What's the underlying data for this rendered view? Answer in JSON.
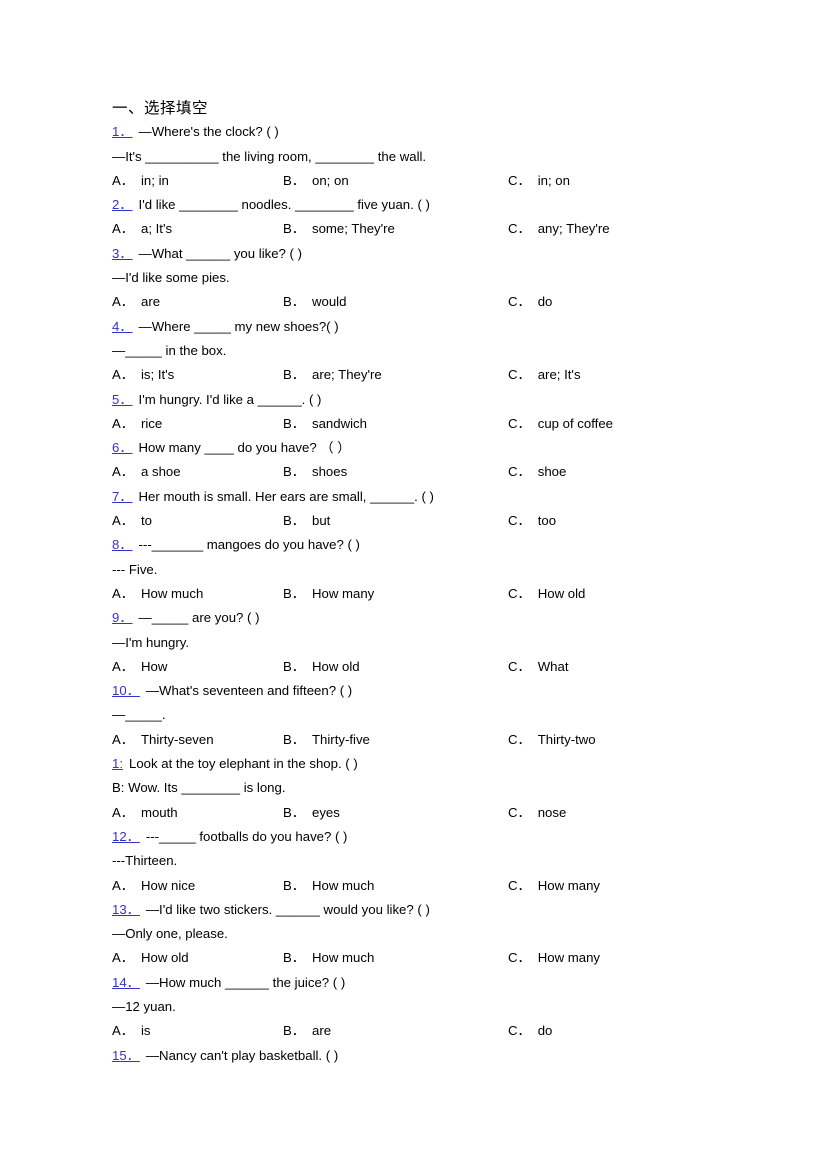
{
  "document": {
    "section_heading": "一、选择填空",
    "option_columns": [
      "A．",
      "B．",
      "C．"
    ],
    "questions": [
      {
        "number": "1．",
        "lines": [
          "—Where's the clock? ( )",
          "—It's __________ the living room, ________ the wall."
        ],
        "options": [
          "in; in",
          "on; on",
          "in; on"
        ]
      },
      {
        "number": "2．",
        "lines": [
          "I'd like ________ noodles. ________ five yuan. ( )"
        ],
        "options": [
          "a; It's",
          "some; They're",
          "any; They're"
        ]
      },
      {
        "number": "3．",
        "lines": [
          "—What ______ you like? ( )",
          "—I'd like some pies."
        ],
        "options": [
          "are",
          "would",
          "do"
        ]
      },
      {
        "number": "4．",
        "lines": [
          "—Where _____ my new shoes?( )",
          "—_____ in the box."
        ],
        "options": [
          "is; It's",
          "are; They're",
          "are; It's"
        ]
      },
      {
        "number": "5．",
        "lines": [
          "I'm hungry. I'd like a ______. ( )"
        ],
        "options": [
          "rice",
          "sandwich",
          "cup of coffee"
        ]
      },
      {
        "number": "6．",
        "lines": [
          "How many ____ do you have? （ ）"
        ],
        "options": [
          "a shoe",
          "shoes",
          "shoe"
        ]
      },
      {
        "number": "7．",
        "lines": [
          "Her mouth is small. Her ears are small, ______. ( )"
        ],
        "options": [
          "to",
          "but",
          "too"
        ]
      },
      {
        "number": "8．",
        "lines": [
          "---_______ mangoes do you have? ( )",
          "--- Five."
        ],
        "options": [
          "How much",
          "How many",
          "How old"
        ]
      },
      {
        "number": "9．",
        "lines": [
          "—_____ are you? ( )",
          "—I'm hungry."
        ],
        "options": [
          "How",
          "How old",
          "What"
        ]
      },
      {
        "number": "10．",
        "lines": [
          "—What's seventeen and fifteen? ( )",
          "—_____."
        ],
        "options": [
          "Thirty-seven",
          "Thirty-five",
          "Thirty-two"
        ]
      },
      {
        "number": "1:",
        "lines": [
          "Look at the toy elephant in the shop. ( )",
          "B: Wow. Its ________ is long."
        ],
        "options": [
          "mouth",
          "eyes",
          "nose"
        ]
      },
      {
        "number": "12．",
        "lines": [
          "---_____ footballs do you have? ( )",
          "---Thirteen."
        ],
        "options": [
          "How nice",
          "How much",
          "How many"
        ]
      },
      {
        "number": "13．",
        "lines": [
          "—I'd like two stickers. ______ would you like? ( )",
          "—Only one, please."
        ],
        "options": [
          "How old",
          "How much",
          "How many"
        ]
      },
      {
        "number": "14．",
        "lines": [
          "—How much ______ the juice? ( )",
          "—12 yuan."
        ],
        "options": [
          "is",
          "are",
          "do"
        ]
      },
      {
        "number": "15．",
        "lines": [
          "—Nancy can't play basketball. ( )"
        ],
        "options": []
      }
    ]
  },
  "colors": {
    "question_number": "#3333cc",
    "body_text": "#000000",
    "page_background": "#ffffff"
  }
}
